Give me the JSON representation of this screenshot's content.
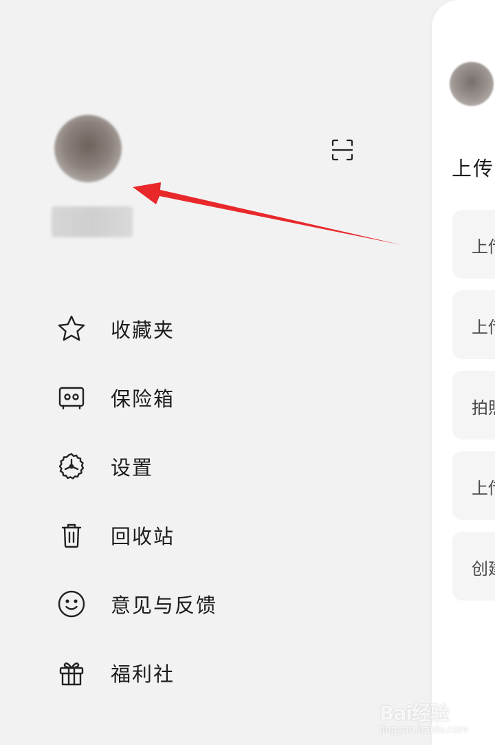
{
  "drawer": {
    "username": "",
    "menu": [
      {
        "label": "收藏夹",
        "icon": "star-icon"
      },
      {
        "label": "保险箱",
        "icon": "safe-icon"
      },
      {
        "label": "设置",
        "icon": "gear-icon"
      },
      {
        "label": "回收站",
        "icon": "trash-icon"
      },
      {
        "label": "意见与反馈",
        "icon": "smiley-icon"
      },
      {
        "label": "福利社",
        "icon": "gift-icon"
      }
    ],
    "scan_icon": "scan-icon"
  },
  "peek_panel": {
    "title": "上传",
    "cards": [
      {
        "label": "上传"
      },
      {
        "label": "上传"
      },
      {
        "label": "拍照"
      },
      {
        "label": "上传"
      },
      {
        "label": "创建"
      }
    ]
  },
  "annotation": {
    "arrow_color": "#e8282b"
  },
  "watermark": {
    "brand": "Bai经验",
    "url": "jingyan.baidu.com"
  }
}
